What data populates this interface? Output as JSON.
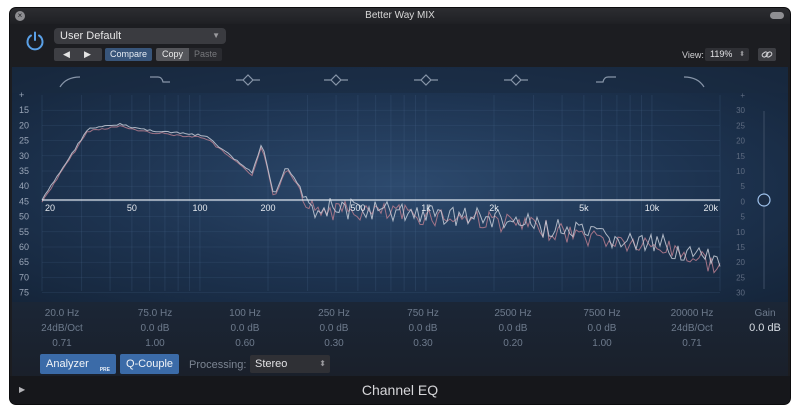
{
  "window": {
    "title": "Better Way MIX"
  },
  "header": {
    "preset": "User Default",
    "compare_label": "Compare",
    "copy_label": "Copy",
    "paste_label": "Paste",
    "view_label": "View:",
    "view_value": "119%"
  },
  "eq": {
    "band_shapes": [
      "low-cut-icon",
      "low-shelf-icon",
      "bell-icon",
      "bell-icon",
      "bell-icon",
      "bell-icon",
      "high-shelf-icon",
      "high-cut-icon"
    ],
    "db_left": [
      "+",
      "15",
      "20",
      "25",
      "30",
      "35",
      "40",
      "45",
      "50",
      "55",
      "60",
      "65",
      "70",
      "75",
      "-"
    ],
    "db_right": [
      "+",
      "30",
      "25",
      "20",
      "15",
      "10",
      "5",
      "0",
      "5",
      "10",
      "15",
      "20",
      "25",
      "30",
      "-"
    ],
    "freq_labels": [
      "20",
      "50",
      "100",
      "200",
      "500",
      "1k",
      "2k",
      "5k",
      "10k",
      "20k"
    ],
    "colors": {
      "curve": "#c9cfd9",
      "analyzer": "#b07a8c",
      "accent": "#3b6ba8"
    }
  },
  "bands": [
    {
      "freq": "20.0 Hz",
      "gain": "24dB/Oct",
      "q": "0.71"
    },
    {
      "freq": "75.0 Hz",
      "gain": "0.0 dB",
      "q": "1.00"
    },
    {
      "freq": "100 Hz",
      "gain": "0.0 dB",
      "q": "0.60"
    },
    {
      "freq": "250 Hz",
      "gain": "0.0 dB",
      "q": "0.30"
    },
    {
      "freq": "750 Hz",
      "gain": "0.0 dB",
      "q": "0.30"
    },
    {
      "freq": "2500 Hz",
      "gain": "0.0 dB",
      "q": "0.20"
    },
    {
      "freq": "7500 Hz",
      "gain": "0.0 dB",
      "q": "1.00"
    },
    {
      "freq": "20000 Hz",
      "gain": "24dB/Oct",
      "q": "0.71"
    }
  ],
  "gain": {
    "label": "Gain",
    "value": "0.0 dB"
  },
  "controls": {
    "analyzer_label": "Analyzer",
    "analyzer_badge": "PRE",
    "qcouple_label": "Q-Couple",
    "processing_label": "Processing:",
    "processing_value": "Stereo"
  },
  "footer": {
    "plugin_name": "Channel EQ"
  }
}
